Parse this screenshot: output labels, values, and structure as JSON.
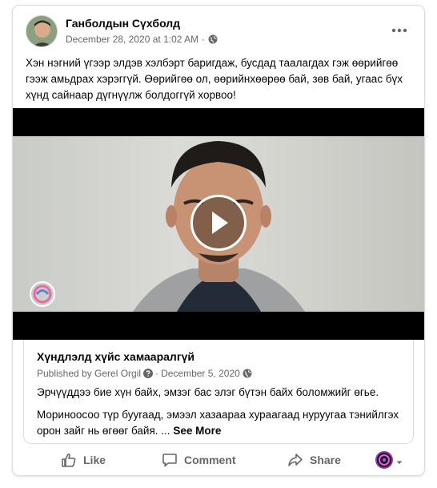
{
  "post": {
    "author": "Ганболдын Сүхболд",
    "date": "December 28, 2020 at 1:02 AM",
    "dot": "·",
    "text": "Хэн нэгний үгээр элдэв хэлбэрт баригдаж, бусдад таалагдах гэж өөрийгөө гээж амьдрах хэрэггүй. Өөрийгөө ол, өөрийнхөөрөө бай, зөв бай, угаас бүх хүнд сайнаар дүгнүүлж болдоггүй хорвоо!"
  },
  "link_preview": {
    "title": "Хүндлэлд хүйс хамааралгүй",
    "published_prefix": "Published by Gerel Orgil",
    "date": "December 5, 2020",
    "dot": "·",
    "paragraph1": "Эрчүүддээ биe хүн байх, эмзэг бас элэг бүтэн байх боломжийг өгье.",
    "paragraph2": "Мориноосоо түр бууraад, эмээл хазаараа хураагаад нуруугаа тэнийлгэх орон зайг нь өгөөг байя. ...",
    "see_more": "See More"
  },
  "actions": {
    "like": "Like",
    "comment": "Comment",
    "share": "Share"
  },
  "icons": {
    "globe": "globe-icon",
    "more": "more-icon",
    "play": "play-icon",
    "like": "like-icon",
    "comment": "comment-icon",
    "share": "share-icon",
    "question": "question-icon",
    "chevron": "chevron-down-icon"
  },
  "colors": {
    "secondary_text": "#65676b",
    "border": "#dadde1",
    "video_bg": "#000000"
  }
}
